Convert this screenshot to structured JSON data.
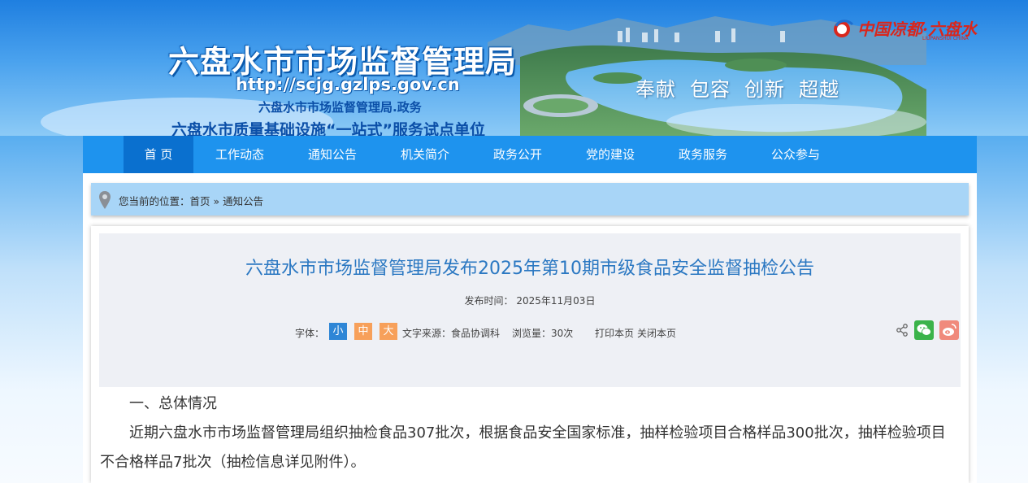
{
  "header": {
    "site_title": "六盘水市市场监督管理局",
    "site_url": "http://scjg.gzlps.gov.cn",
    "subtitle": "六盘水市市场监督管理局.政务",
    "subtitle2": "六盘水市质量基础设施“一站式”服务试点单位",
    "slogan": [
      "奉献",
      "包容",
      "创新",
      "超越"
    ],
    "city_logo_text": "中国凉都·六盘水",
    "city_logo_en": "LIUPANSHUI CHINA"
  },
  "nav": {
    "items": [
      {
        "label": "首 页",
        "active": true
      },
      {
        "label": "工作动态"
      },
      {
        "label": "通知公告"
      },
      {
        "label": "机关简介"
      },
      {
        "label": "政务公开"
      },
      {
        "label": "党的建设"
      },
      {
        "label": "政务服务"
      },
      {
        "label": "公众参与"
      }
    ]
  },
  "breadcrumb": {
    "prefix": "您当前的位置：",
    "home": "首页",
    "sep": " » ",
    "current": "通知公告"
  },
  "article": {
    "title": "六盘水市市场监督管理局发布2025年第10期市级食品安全监督抽检公告",
    "publish_time": "发布时间： 2025年11月03日",
    "font_label": "字体：",
    "font_small": "小",
    "font_mid": "中",
    "font_big": "大",
    "source": "文字来源：食品协调科",
    "views": "浏览量：30次",
    "print": "打印本页",
    "close": "关闭本页",
    "paragraphs": [
      "一、总体情况",
      "近期六盘水市市场监督管理局组织抽检食品307批次，根据食品安全国家标准，抽样检验项目合格样品300批次，抽样检验项目不合格样品7批次（抽检信息详见附件）。"
    ]
  },
  "colors": {
    "nav_bg": "#1e93ee",
    "nav_active": "#0a70cf",
    "title_blue": "#2b78c2",
    "breadcrumb_bg": "#a8d5f7"
  }
}
